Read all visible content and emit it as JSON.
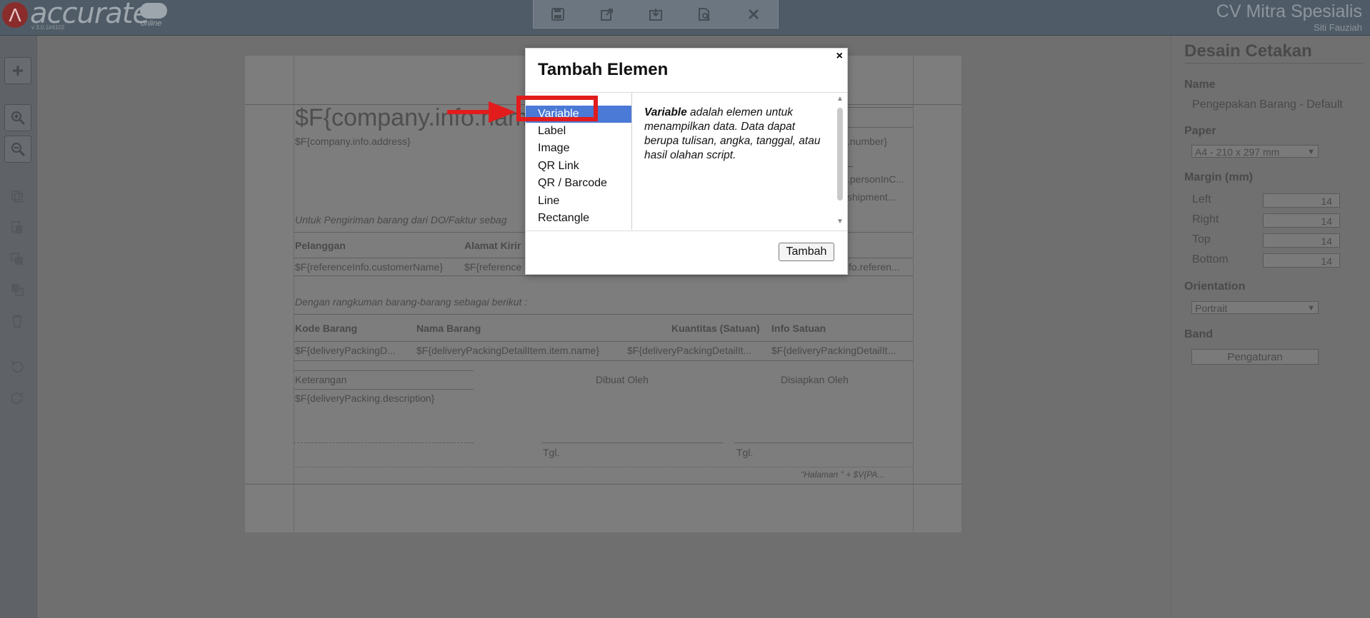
{
  "app": {
    "logo_text": "accurate",
    "logo_sub": "online",
    "version": "v 3.0.1#4102",
    "company": "CV Mitra Spesialis",
    "user": "Siti Fauziah"
  },
  "toolbar": {
    "icons": [
      "save-icon",
      "export-icon",
      "import-icon",
      "preview-icon",
      "close-icon"
    ]
  },
  "left_tools": [
    "add-icon",
    "zoom-in-icon",
    "zoom-out-icon",
    "copy-icon",
    "paste-icon",
    "bring-front-icon",
    "send-back-icon",
    "delete-icon",
    "undo-icon",
    "redo-icon"
  ],
  "paper": {
    "company_name": "$F{company.info.name}",
    "company_address": "$F{company.info.address}",
    "number": ".number}",
    "dash": "_",
    "person": ".personInC...",
    "shipment": "shipment...",
    "intro": "Untuk Pengiriman barang dari DO/Faktur sebag",
    "col_customer": "Pelanggan",
    "col_address": "Alamat Kirir",
    "val_customer": "$F{referenceInfo.customerName}",
    "val_address": "$F{reference",
    "val_ref": "fo.referen...",
    "summary": "Dengan rangkuman barang-barang sebagai berikut :",
    "items_headers": [
      "Kode Barang",
      "Nama Barang",
      "Kuantitas (Satuan)",
      "Info Satuan"
    ],
    "items_values": [
      "$F{deliveryPackingD...",
      "$F{deliveryPackingDetailItem.item.name}",
      "$F{deliveryPackingDetailIt...",
      "$F{deliveryPackingDetailIt..."
    ],
    "notes_label": "Keterangan",
    "notes_value": "$F{deliveryPacking.description}",
    "made_by": "Dibuat Oleh",
    "prepared_by": "Disiapkan Oleh",
    "date1": "Tgl.",
    "date2": "Tgl.",
    "page_footer": "\"Halaman \" + $V{PA..."
  },
  "right_panel": {
    "title": "Desain Cetakan",
    "name_label": "Name",
    "name_value": "Pengepakan Barang - Default",
    "paper_label": "Paper",
    "paper_value": "A4 - 210 x 297 mm",
    "margin_label": "Margin (mm)",
    "margins": [
      {
        "label": "Left",
        "value": "14"
      },
      {
        "label": "Right",
        "value": "14"
      },
      {
        "label": "Top",
        "value": "14"
      },
      {
        "label": "Bottom",
        "value": "14"
      }
    ],
    "orientation_label": "Orientation",
    "orientation_value": "Portrait",
    "band_label": "Band",
    "band_button": "Pengaturan"
  },
  "modal": {
    "title": "Tambah Elemen",
    "close": "×",
    "items": [
      "Variable",
      "Label",
      "Image",
      "QR Link",
      "QR / Barcode",
      "Line",
      "Rectangle"
    ],
    "selected_index": 0,
    "desc_bold": "Variable",
    "desc_rest": " adalah elemen untuk menampilkan data. Data dapat berupa tulisan, angka, tanggal, atau hasil olahan script.",
    "add_button": "Tambah"
  },
  "colors": {
    "selection": "#4a79d6",
    "annotation": "#e21c1c"
  }
}
